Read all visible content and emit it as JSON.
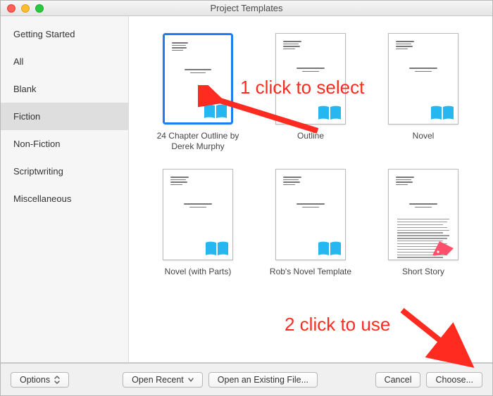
{
  "window": {
    "title": "Project Templates"
  },
  "sidebar": {
    "items": [
      {
        "label": "Getting Started",
        "selected": false
      },
      {
        "label": "All",
        "selected": false
      },
      {
        "label": "Blank",
        "selected": false
      },
      {
        "label": "Fiction",
        "selected": true
      },
      {
        "label": "Non-Fiction",
        "selected": false
      },
      {
        "label": "Scriptwriting",
        "selected": false
      },
      {
        "label": "Miscellaneous",
        "selected": false
      }
    ]
  },
  "templates": [
    {
      "label": "24 Chapter Outline by Derek Murphy",
      "badge": "book",
      "selected": true
    },
    {
      "label": "Outline",
      "badge": "book",
      "selected": false
    },
    {
      "label": "Novel",
      "badge": "book",
      "selected": false
    },
    {
      "label": "Novel (with Parts)",
      "badge": "book",
      "selected": false
    },
    {
      "label": "Rob's Novel Template",
      "badge": "book",
      "selected": false
    },
    {
      "label": "Short Story",
      "badge": "pen",
      "selected": false,
      "body": true
    }
  ],
  "footer": {
    "options": "Options",
    "open_recent": "Open Recent",
    "open_existing": "Open an Existing File...",
    "cancel": "Cancel",
    "choose": "Choose..."
  },
  "annotations": {
    "a1": "1 click to select",
    "a2": "2 click to use"
  },
  "colors": {
    "accent": "#1e7df0",
    "book_icon": "#27b7f0",
    "pen_icon": "#ff4f6b",
    "annotation": "#ff2b20"
  }
}
